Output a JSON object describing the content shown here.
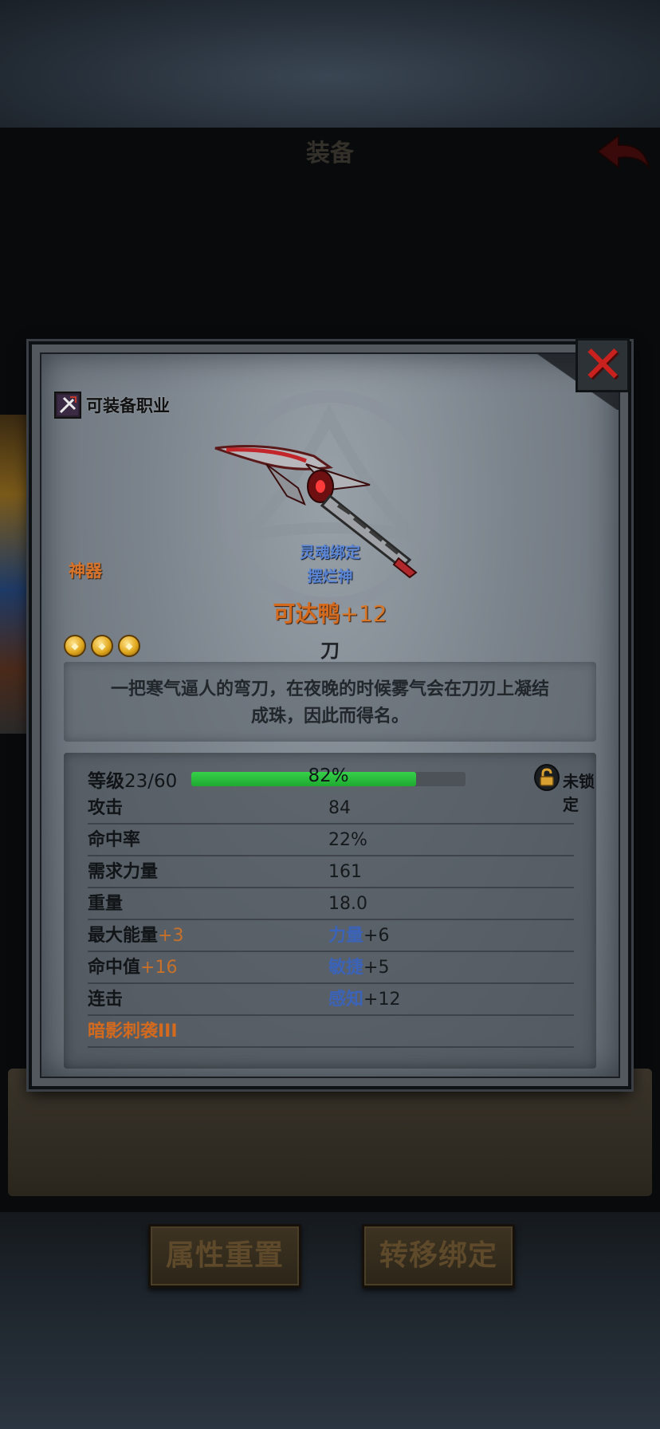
{
  "background": {
    "title": "装备",
    "buttons": {
      "reset_label": "属性重置",
      "transfer_label": "转移绑定"
    }
  },
  "panel": {
    "equip_class_label": "可装备职业",
    "rarity": "神器",
    "soulbind": "灵魂绑定",
    "owner": "摆烂神",
    "item_name": "可达鸭",
    "enhance_level": "+12",
    "item_type": "刀",
    "star_count": 3,
    "description_line1": "一把寒气逼人的弯刀，在夜晚的时候雾气会在刀刃上凝结",
    "description_line2": "成珠，因此而得名。",
    "level": {
      "label": "等级",
      "value": "23/60",
      "progress_text": "82%",
      "progress": 0.82,
      "lock_label": "未锁定"
    },
    "stats": [
      {
        "label": "攻击",
        "value": "84"
      },
      {
        "label": "命中率",
        "value": "22%"
      },
      {
        "label": "需求力量",
        "value": "161"
      },
      {
        "label": "重量",
        "value": "18.0"
      }
    ],
    "bonuses": [
      {
        "left_name": "最大能量",
        "left_val": "+3",
        "right_name": "力量",
        "right_val": "+6"
      },
      {
        "left_name": "命中值",
        "left_val": "+16",
        "right_name": "敏捷",
        "right_val": "+5"
      },
      {
        "left_name": "连击",
        "left_val": "",
        "right_name": "感知",
        "right_val": "+12"
      }
    ],
    "skill": "暗影刺袭III"
  },
  "colors": {
    "rarity_orange": "#d46a1e",
    "bind_blue": "#5b86d6",
    "xp_green": "#2bc23e",
    "close_red": "#c8211e"
  },
  "icons": [
    "back-arrow-icon",
    "close-icon",
    "class-icon",
    "star-icon",
    "lock-icon",
    "weapon-image"
  ]
}
